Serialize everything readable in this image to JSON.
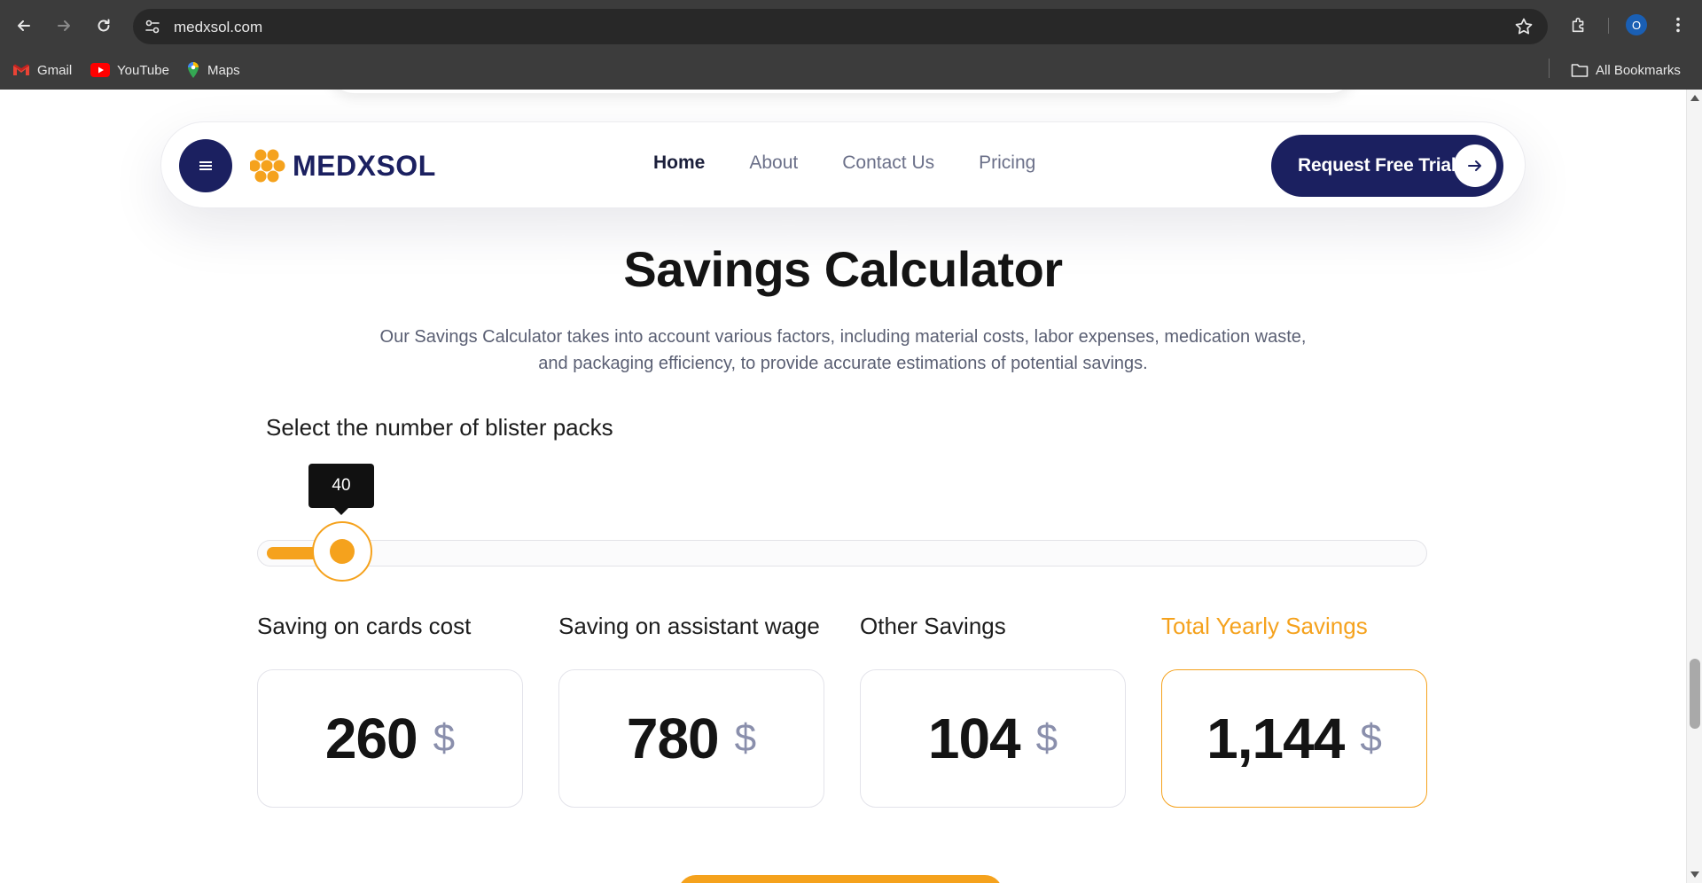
{
  "browser": {
    "url": "medxsol.com",
    "bookmarks": [
      {
        "label": "Gmail",
        "icon": "gmail-icon"
      },
      {
        "label": "YouTube",
        "icon": "youtube-icon"
      },
      {
        "label": "Maps",
        "icon": "maps-icon"
      }
    ],
    "all_bookmarks_label": "All Bookmarks",
    "profile_initial": "O"
  },
  "header": {
    "logo_text": "MEDXSOL",
    "nav": [
      {
        "label": "Home",
        "active": true
      },
      {
        "label": "About",
        "active": false
      },
      {
        "label": "Contact Us",
        "active": false
      },
      {
        "label": "Pricing",
        "active": false
      }
    ],
    "cta_label": "Request Free Trial"
  },
  "section": {
    "title": "Savings Calculator",
    "subtitle": "Our Savings Calculator takes into account various factors, including material costs, labor expenses, medication waste, and packaging efficiency, to provide accurate estimations of potential savings."
  },
  "slider": {
    "label": "Select the number of blister packs",
    "value": "40",
    "fill_fraction": 0.05
  },
  "stats": [
    {
      "label": "Saving on cards cost",
      "value": "260",
      "unit": "$",
      "highlight": false
    },
    {
      "label": "Saving on assistant wage",
      "value": "780",
      "unit": "$",
      "highlight": false
    },
    {
      "label": "Other Savings",
      "value": "104",
      "unit": "$",
      "highlight": false
    },
    {
      "label": "Total Yearly Savings",
      "value": "1,144",
      "unit": "$",
      "highlight": true
    }
  ],
  "colors": {
    "navy": "#1b2060",
    "accent": "#f5a21d",
    "chrome": "#3c3c3c"
  }
}
